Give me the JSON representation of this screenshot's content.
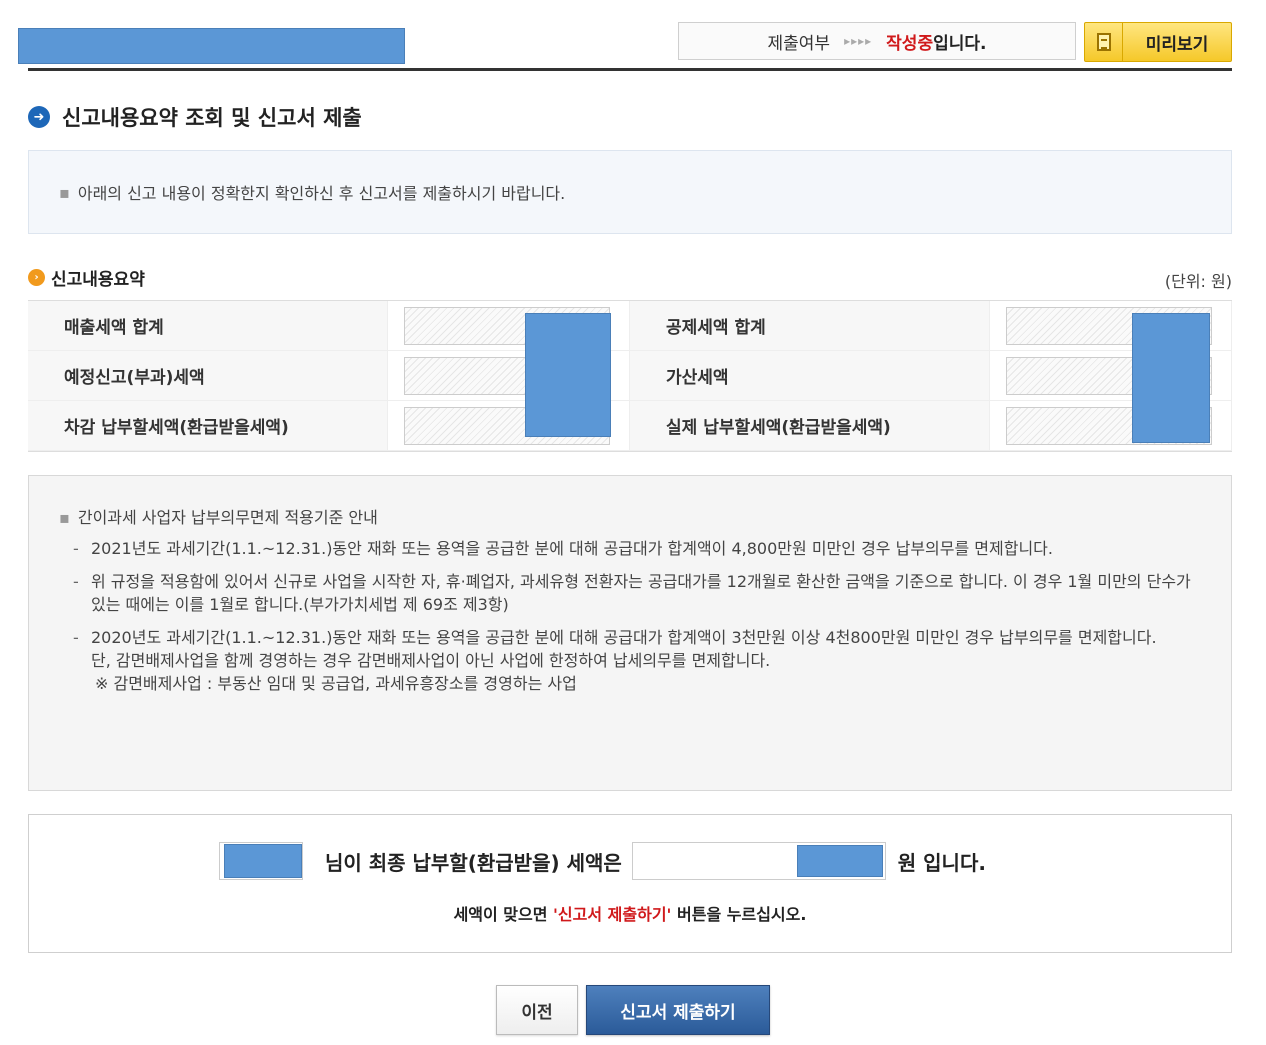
{
  "header": {
    "status_label": "제출여부",
    "status_arrows": "▸▸▸▸",
    "status_value": "작성중",
    "status_suffix": "입니다.",
    "preview_label": "미리보기"
  },
  "title": "신고내용요약 조회 및 신고서 제출",
  "info": {
    "bullet": "▪",
    "text": "아래의 신고 내용이 정확한지 확인하신 후 신고서를 제출하시기 바랍니다."
  },
  "summary": {
    "title": "신고내용요약",
    "unit": "(단위: 원)",
    "rows": [
      {
        "left_label": "매출세액 합계",
        "right_label": "공제세액 합계"
      },
      {
        "left_label": "예정신고(부과)세액",
        "right_label": "가산세액"
      },
      {
        "left_label": "차감 납부할세액(환급받을세액)",
        "right_label": "실제 납부할세액(환급받을세액)"
      }
    ]
  },
  "notice": {
    "head": "간이과세 사업자 납부의무면제 적용기준 안내",
    "dash": "-",
    "items": [
      "2021년도 과세기간(1.1.~12.31.)동안 재화 또는 용역을 공급한 분에 대해 공급대가 합계액이 4,800만원 미만인 경우 납부의무를 면제합니다.",
      "위 규정을 적용함에 있어서 신규로 사업을 시작한 자, 휴·폐업자, 과세유형 전환자는 공급대가를 12개월로 환산한 금액을 기준으로 합니다. 이 경우 1월 미만의 단수가 있는 때에는 이를 1월로 합니다.(부가가치세법 제 69조 제3항)",
      "2020년도 과세기간(1.1.~12.31.)동안 재화 또는 용역을 공급한 분에 대해 공급대가 합계액이 3천만원 이상 4천800만원 미만인 경우 납부의무를 면제합니다."
    ],
    "extra1": "단, 감면배제사업을 함께 경영하는 경우 감면배제사업이 아닌 사업에 한정하여 납세의무를 면제합니다.",
    "extra2": "※ 감면배제사업 : 부동산 임대 및 공급업, 과세유흥장소를 경영하는 사업"
  },
  "final": {
    "text_mid": "님이 최종 납부할(환급받을) 세액은",
    "text_won": "원 입니다.",
    "note_prefix": "세액이 맞으면 ",
    "note_red": "'신고서 제출하기'",
    "note_suffix": " 버튼을 누르십시오."
  },
  "buttons": {
    "prev": "이전",
    "submit": "신고서 제출하기"
  },
  "colors": {
    "accent_red": "#d0191b",
    "submit_blue": "#2b5b99",
    "preview_yellow": "#f5c829",
    "redaction": "#5b97d6"
  }
}
